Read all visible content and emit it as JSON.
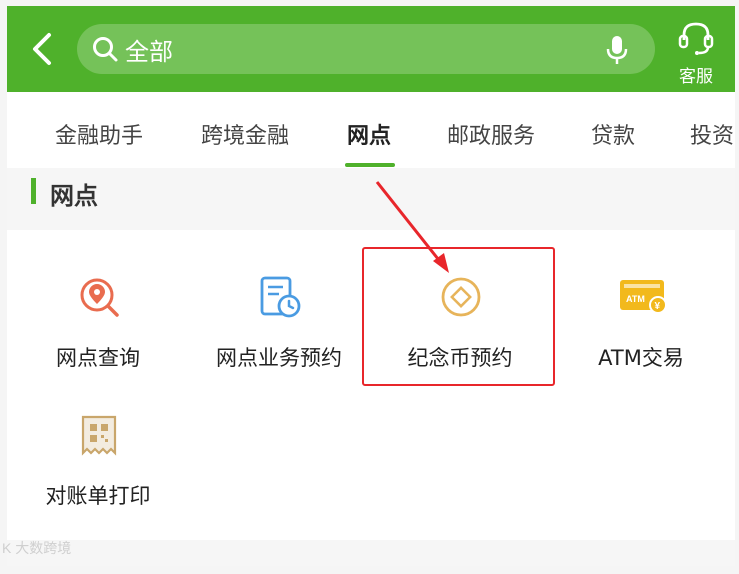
{
  "header": {
    "back_icon": "chevron-left-icon",
    "search": {
      "icon": "search-icon",
      "text": "全部",
      "mic_icon": "mic-icon"
    },
    "service": {
      "icon": "headset-icon",
      "label": "客服"
    },
    "brand_color": "#4fb12b"
  },
  "tabs": [
    {
      "label": "金融助手",
      "active": false
    },
    {
      "label": "跨境金融",
      "active": false
    },
    {
      "label": "网点",
      "active": true
    },
    {
      "label": "邮政服务",
      "active": false
    },
    {
      "label": "贷款",
      "active": false
    },
    {
      "label": "投资",
      "active": false
    }
  ],
  "section": {
    "title": "网点"
  },
  "grid": [
    {
      "label": "网点查询",
      "icon": "location-search-icon",
      "icon_color": "#e96c4f"
    },
    {
      "label": "网点业务预约",
      "icon": "document-clock-icon",
      "icon_color": "#4a9be2"
    },
    {
      "label": "纪念币预约",
      "icon": "coin-icon",
      "icon_color": "#e7b45a",
      "highlighted": true
    },
    {
      "label": "ATM交易",
      "icon": "atm-card-icon",
      "icon_color": "#f2b91c"
    },
    {
      "label": "对账单打印",
      "icon": "receipt-qr-icon",
      "icon_color": "#c9a66b"
    }
  ],
  "annotation": {
    "color": "#e8262b"
  },
  "watermark": "K 大数跨境"
}
